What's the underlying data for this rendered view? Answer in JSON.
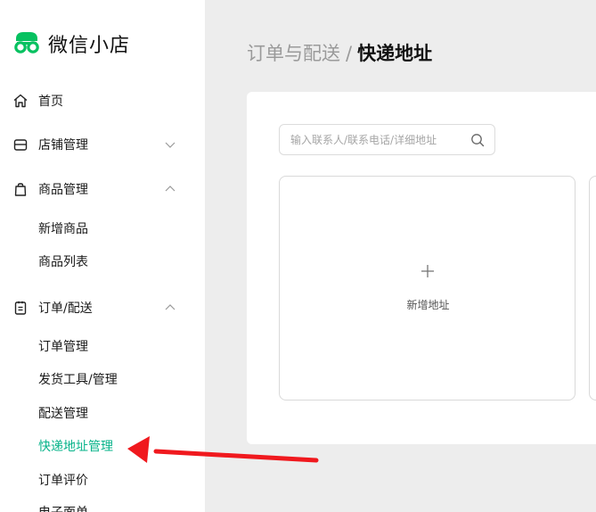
{
  "app": {
    "name": "微信小店",
    "brand_color": "#07c160"
  },
  "sidebar": {
    "items": [
      {
        "label": "首页",
        "icon": "home-icon"
      },
      {
        "label": "店铺管理",
        "icon": "store-icon",
        "expanded": false
      },
      {
        "label": "商品管理",
        "icon": "shopping-bag-icon",
        "expanded": true,
        "children": [
          "新增商品",
          "商品列表"
        ]
      },
      {
        "label": "订单/配送",
        "icon": "clipboard-icon",
        "expanded": true,
        "children": [
          "订单管理",
          "发货工具/管理",
          "配送管理",
          "快递地址管理",
          "订单评价",
          "电子面单"
        ]
      }
    ],
    "active_item": "快递地址管理",
    "active_color": "#07b38a"
  },
  "breadcrumb": {
    "parent": "订单与配送",
    "separator": "/",
    "current": "快递地址"
  },
  "search": {
    "placeholder": "输入联系人/联系电话/详细地址",
    "value": ""
  },
  "add_address": {
    "label": "新增地址"
  },
  "annotation": {
    "arrow_color": "#f0191e",
    "points_to": "快递地址管理"
  }
}
